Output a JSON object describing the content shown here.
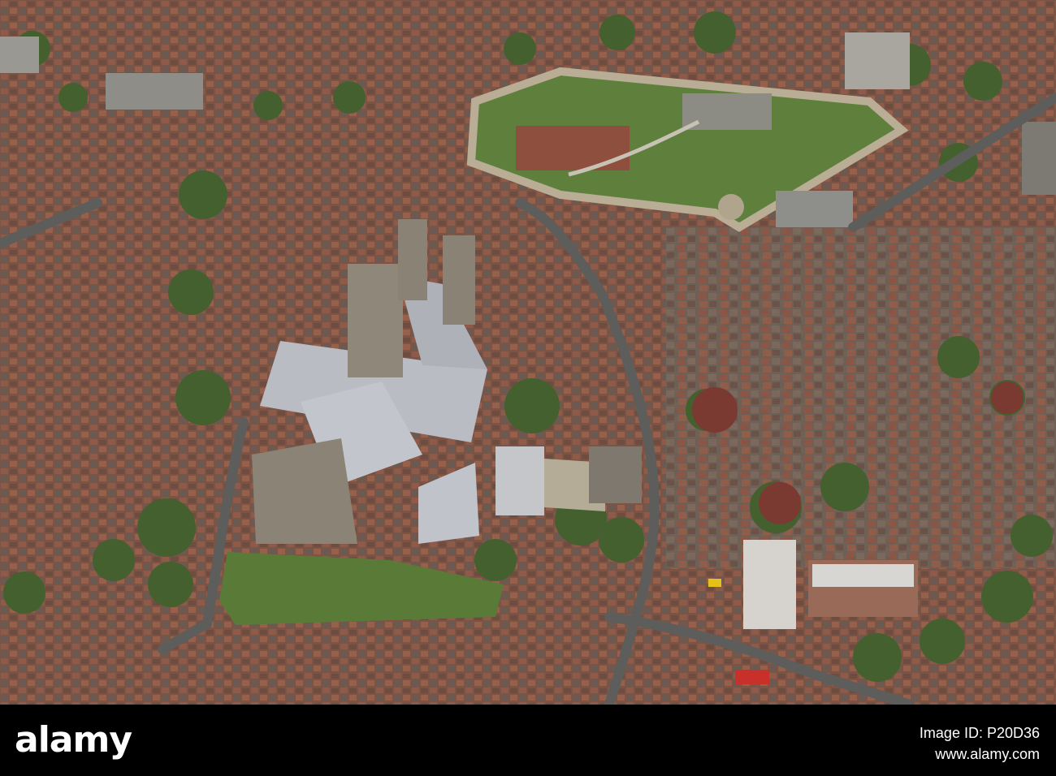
{
  "image": {
    "alt": "Aerial view of a cathedral and a walled castle in a dense town"
  },
  "footer": {
    "brand": "alamy",
    "image_id": "Image ID: P20D36",
    "site": "www.alamy.com"
  },
  "colors": {
    "roof_red": "#8a4a3a",
    "stone": "#9e9484",
    "lead_roof": "#b9bcc2",
    "grass": "#5f7a3e",
    "tree": "#3f5a2c",
    "road": "#5b5b5b"
  }
}
